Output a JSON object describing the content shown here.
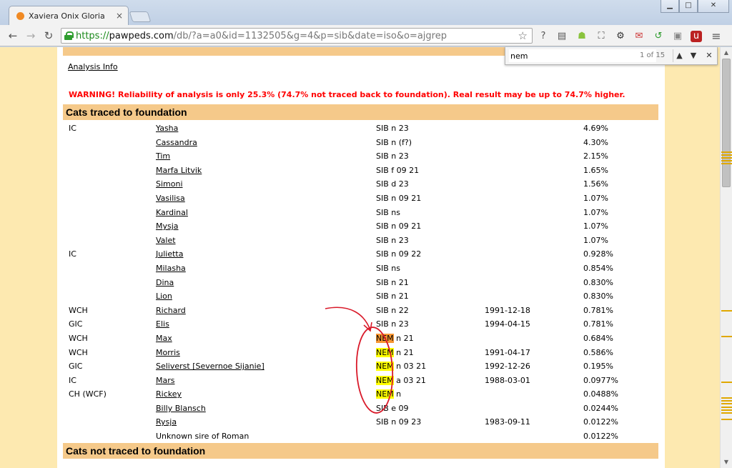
{
  "window": {
    "tab_title": "Xaviera Onix Gloria",
    "tab_close": "×",
    "min": "▁",
    "max": "□",
    "close": "✕"
  },
  "toolbar": {
    "back": "←",
    "forward": "→",
    "reload": "↻",
    "url_scheme": "https://",
    "url_host": "pawpeds.com",
    "url_rest": "/db/?a=a0&id=1132505&g=4&p=sib&date=iso&o=ajgrep",
    "star": "☆",
    "menu": "≡"
  },
  "findbar": {
    "query": "nem",
    "count": "1 of 15",
    "prev": "▲",
    "next": "▼",
    "close": "✕"
  },
  "page": {
    "analysis_link": "Analysis Info",
    "warning": "WARNING! Reliability of analysis is only 25.3% (74.7% not traced back to foundation). Real result may be up to 74.7% higher.",
    "section_traced": "Cats traced to foundation",
    "section_not_traced": "Cats not traced to foundation"
  },
  "rows": [
    {
      "title": "IC",
      "name": "Yasha",
      "hl": "",
      "reg": "SIB n 23",
      "date": "",
      "pct": "4.69%"
    },
    {
      "title": "",
      "name": "Cassandra",
      "hl": "",
      "reg": "SIB n (f?)",
      "date": "",
      "pct": "4.30%"
    },
    {
      "title": "",
      "name": "Tim",
      "hl": "",
      "reg": "SIB n 23",
      "date": "",
      "pct": "2.15%"
    },
    {
      "title": "",
      "name": "Marfa Litvik",
      "hl": "",
      "reg": "SIB f 09 21",
      "date": "",
      "pct": "1.65%"
    },
    {
      "title": "",
      "name": "Simoni",
      "hl": "",
      "reg": "SIB d 23",
      "date": "",
      "pct": "1.56%"
    },
    {
      "title": "",
      "name": "Vasilisa",
      "hl": "",
      "reg": "SIB n 09 21",
      "date": "",
      "pct": "1.07%"
    },
    {
      "title": "",
      "name": "Kardinal",
      "hl": "",
      "reg": "SIB ns",
      "date": "",
      "pct": "1.07%"
    },
    {
      "title": "",
      "name": "Mysja",
      "hl": "",
      "reg": "SIB n 09 21",
      "date": "",
      "pct": "1.07%"
    },
    {
      "title": "",
      "name": "Valet",
      "hl": "",
      "reg": "SIB n 23",
      "date": "",
      "pct": "1.07%"
    },
    {
      "title": "IC",
      "name": "Julietta",
      "hl": "",
      "reg": "SIB n 09 22",
      "date": "",
      "pct": "0.928%"
    },
    {
      "title": "",
      "name": "Milasha",
      "hl": "",
      "reg": "SIB ns",
      "date": "",
      "pct": "0.854%"
    },
    {
      "title": "",
      "name": "Dina",
      "hl": "",
      "reg": "SIB n 21",
      "date": "",
      "pct": "0.830%"
    },
    {
      "title": "",
      "name": "Lion",
      "hl": "",
      "reg": "SIB n 21",
      "date": "",
      "pct": "0.830%"
    },
    {
      "title": "WCH",
      "name": "Richard",
      "hl": "",
      "reg": "SIB n 22",
      "date": "1991-12-18",
      "pct": "0.781%"
    },
    {
      "title": "GIC",
      "name": "Elis",
      "hl": "",
      "reg": "SIB n 23",
      "date": "1994-04-15",
      "pct": "0.781%"
    },
    {
      "title": "WCH",
      "name": "Max",
      "hl": "NEM",
      "reg": " n 21",
      "date": "",
      "pct": "0.684%"
    },
    {
      "title": "WCH",
      "name": "Morris",
      "hl": "NEM",
      "reg": " n 21",
      "date": "1991-04-17",
      "pct": "0.586%"
    },
    {
      "title": "GIC",
      "name": "Seliverst [Severnoe Sijanie]",
      "hl": "NEM",
      "reg": " n 03 21",
      "date": "1992-12-26",
      "pct": "0.195%"
    },
    {
      "title": "IC",
      "name": "Mars",
      "hl": "NEM",
      "reg": " a 03 21",
      "date": "1988-03-01",
      "pct": "0.0977%"
    },
    {
      "title": "CH (WCF)",
      "name": "Rickey",
      "hl": "NEM",
      "reg": " n",
      "date": "",
      "pct": "0.0488%"
    },
    {
      "title": "",
      "name": "Billy Blansch",
      "hl": "",
      "reg": "SIB e 09",
      "date": "",
      "pct": "0.0244%"
    },
    {
      "title": "",
      "name": "Rysja",
      "hl": "",
      "reg": "SIB n 09 23",
      "date": "1983-09-11",
      "pct": "0.0122%"
    },
    {
      "title": "",
      "name": "Unknown sire of Roman",
      "hl": "",
      "reg": "",
      "date": "",
      "pct": "0.0122%",
      "plain": true
    }
  ],
  "colors": {
    "warning": "#ff0000",
    "section_bg": "#f5c98a",
    "page_bg": "#fde9b0",
    "highlight": "#ffff00",
    "active_highlight": "#f79632",
    "annotation": "#d91a2a"
  }
}
